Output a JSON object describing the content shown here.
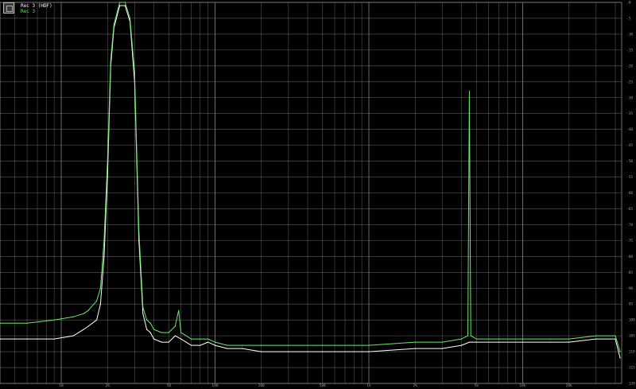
{
  "chart_data": {
    "type": "line",
    "x_scale": "log",
    "xlim": [
      4,
      44000
    ],
    "ylim": [
      -120,
      0
    ],
    "grid": true,
    "legend_position": "top-left",
    "background": "#000000",
    "grid_color": "#8a8a8a",
    "x_tick_labels": [
      "10",
      "20",
      "50",
      "100",
      "200",
      "500",
      "1k",
      "2k",
      "5k",
      "10k",
      "20k"
    ],
    "y_tick_labels": [
      "-0",
      "-5",
      "-10",
      "-15",
      "-20",
      "-25",
      "-30",
      "-35",
      "-40",
      "-45",
      "-50",
      "-55",
      "-60",
      "-65",
      "-70",
      "-75",
      "-80",
      "-85",
      "-90",
      "-95",
      "-100",
      "-105",
      "-110",
      "-115",
      "-120"
    ],
    "series": [
      {
        "name": "Rec 3 (HDF)",
        "color": "#ffffff",
        "x": [
          4,
          6,
          9,
          12,
          14,
          15,
          17,
          18,
          19,
          20,
          21,
          22,
          24,
          26,
          28,
          30,
          32,
          34,
          36,
          38,
          40,
          45,
          50,
          55,
          60,
          70,
          80,
          90,
          100,
          120,
          150,
          200,
          300,
          500,
          1000,
          2000,
          3000,
          4000,
          4500,
          4700,
          5000,
          7000,
          10000,
          15000,
          20000,
          30000,
          40000,
          43000
        ],
        "y": [
          -106,
          -106,
          -106,
          -105,
          -103,
          -102,
          -100,
          -95,
          -80,
          -55,
          -20,
          -8,
          -1,
          -1,
          -6,
          -25,
          -75,
          -98,
          -103,
          -104,
          -106,
          -107,
          -107,
          -105,
          -106,
          -108,
          -108,
          -107,
          -108,
          -109,
          -109,
          -110,
          -110,
          -110,
          -110,
          -109,
          -109,
          -108,
          -107,
          -107,
          -107,
          -107,
          -107,
          -107,
          -107,
          -106,
          -106,
          -112
        ]
      },
      {
        "name": "Rec 3",
        "color": "#6ce86c",
        "x": [
          4,
          6,
          9,
          12,
          14,
          15,
          17,
          18,
          19,
          20,
          21,
          22,
          24,
          26,
          28,
          30,
          32,
          34,
          36,
          38,
          40,
          45,
          50,
          55,
          58,
          60,
          70,
          80,
          90,
          100,
          120,
          150,
          200,
          300,
          500,
          1000,
          2000,
          3000,
          4000,
          4400,
          4500,
          4600,
          5000,
          7000,
          10000,
          15000,
          20000,
          30000,
          40000,
          43000
        ],
        "y": [
          -101,
          -101,
          -100,
          -99,
          -98,
          -97,
          -94,
          -90,
          -75,
          -50,
          -18,
          -7,
          0,
          0,
          -5,
          -22,
          -72,
          -96,
          -100,
          -101,
          -103,
          -104,
          -104,
          -102,
          -97,
          -104,
          -106,
          -106,
          -106,
          -107,
          -108,
          -108,
          -108,
          -108,
          -108,
          -108,
          -107,
          -107,
          -106,
          -105,
          -28,
          -105,
          -106,
          -106,
          -106,
          -106,
          -106,
          -105,
          -105,
          -110
        ]
      }
    ]
  }
}
